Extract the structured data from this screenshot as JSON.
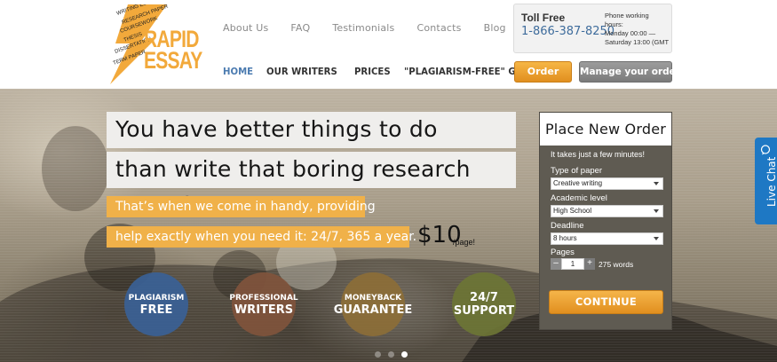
{
  "brand": {
    "line1": "RAPID",
    "line2": "ESSAY"
  },
  "top_nav": [
    "About Us",
    "FAQ",
    "Testimonials",
    "Contacts",
    "Blog"
  ],
  "main_nav": [
    {
      "label": "HOME",
      "active": true
    },
    {
      "label": "OUR WRITERS",
      "active": false
    },
    {
      "label": "PRICES",
      "active": false
    },
    {
      "label": "\"PLAGIARISM-FREE\" GUARANTEE",
      "active": false
    }
  ],
  "contact": {
    "label": "Toll Free",
    "phone": "1-866-387-8250",
    "hours_line1": "Phone working",
    "hours_line2": "hours:",
    "hours_line3": "Monday 00:00 —",
    "hours_line4": "Saturday 13:00 (GMT"
  },
  "header_buttons": {
    "order": "Order now",
    "manage": "Manage your orders"
  },
  "hero": {
    "headline1": "You have better things to do",
    "headline2": "than write that boring research paper?",
    "sub1": "That’s when we come in handy, providing",
    "sub2": "help exactly when you need it: 24/7, 365 a year.",
    "price": "$10",
    "price_unit": "/page!"
  },
  "features": [
    {
      "top": "PLAGIARISM",
      "bottom": "FREE"
    },
    {
      "top": "PROFESSIONAL",
      "bottom": "WRITERS"
    },
    {
      "top": "MONEYBACK",
      "bottom": "GUARANTEE"
    },
    {
      "top": "24/7",
      "bottom": "SUPPORT"
    }
  ],
  "slider": {
    "count": 3,
    "active_index": 2
  },
  "order_form": {
    "title": "Place New Order",
    "note": "It takes just a few minutes!",
    "paper_label": "Type of paper",
    "paper_value": "Creative writing",
    "level_label": "Academic level",
    "level_value": "High School",
    "deadline_label": "Deadline",
    "deadline_value": "8 hours",
    "pages_label": "Pages",
    "minus": "–",
    "plus": "+",
    "pages_value": "1",
    "words": "275 words",
    "continue": "CONTINUE"
  },
  "live_chat": "Live Chat",
  "colors": {
    "accent_orange": "#f0b149",
    "brand_blue": "#3e6c9c",
    "chat_blue": "#1e78c4"
  }
}
